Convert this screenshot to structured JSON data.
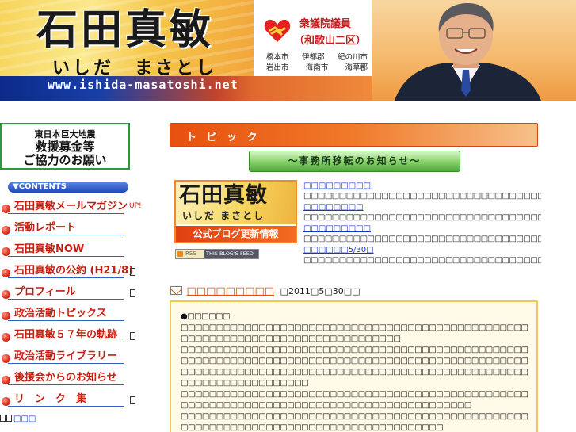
{
  "header": {
    "name": "石田真敏",
    "name_kana": "いしだ　まさとし",
    "url": "www.ishida-masatoshi.net",
    "office_title": "衆議院議員",
    "district": "（和歌山二区）",
    "areas": [
      [
        "橋本市",
        "伊都郡",
        "紀の川市"
      ],
      [
        "岩出市",
        "海南市",
        "海草郡"
      ]
    ],
    "heart_icon": "heart-handshake-icon",
    "colors": {
      "band_blue": "#0c2a8a",
      "accent_orange": "#e8500e",
      "title_red": "#c02020"
    }
  },
  "sidebar": {
    "relief_banner": {
      "line1": "東日本巨大地震",
      "line2": "救援募金等",
      "line3": "ご協力のお願い"
    },
    "contents_label": "▼CONTENTS",
    "items": [
      {
        "label": "石田真敏メールマガジン",
        "extra": "UP!"
      },
      {
        "label": "活動レポート"
      },
      {
        "label": "石田真敏NOW"
      },
      {
        "label": "石田真敏の公約 (H21/8)",
        "box": true
      },
      {
        "label": "プロフィール",
        "box": true
      },
      {
        "label": "政治活動トピックス"
      },
      {
        "label": "石田真敏５７年の軌跡",
        "box": true
      },
      {
        "label": "政治活動ライブラリー"
      },
      {
        "label": "後援会からのお知らせ"
      },
      {
        "label": "リ　ン　ク　集",
        "box": true
      }
    ],
    "footer_link": "□□□"
  },
  "main": {
    "topic_label": "ト ピ ッ ク",
    "notice_button": "～事務所移転のお知らせ～",
    "blog_banner": {
      "name": "石田真敏",
      "kana": "いしだ まさとし",
      "caption": "公式ブログ更新情報"
    },
    "rss": {
      "left": "RSS",
      "right": "THIS BLOG'S FEED"
    },
    "news": [
      {
        "title": "□□□□□□□□□",
        "body": "□□□□□□□□□□□□□□□□□□□□□□□□□□□□□□□□□□□□□□□□□□□□□□□□□□□□"
      },
      {
        "title": "□□□□□□□□",
        "body": "□□□□□□□□□□□□□□□□□□□□□□□□□□□□□□□□□□□□□□□□□□□□□□□□□□□□"
      },
      {
        "title": "□□□□□□□□□",
        "body": "□□□□□□□□□□□□□□□□□□□□□□□□□□□□□□□□□□□□9□□□□□□□□□□□□□□□"
      },
      {
        "title": "□□□□□□5/30□",
        "body": "□□□□□□□□□□□□□□□□□□□□□□□□□□□□□□□□□□□□□□□□□□□□□□□□□□□□"
      }
    ],
    "article": {
      "title": "□□□□□□□□□",
      "date": "□2011□5□30□□",
      "heading": "●□□□□□□",
      "paragraphs": [
        "□□□□□□□□□□□□□□□□□□□□□□□□□□□□□□□□□□□□□□□□□□□□□□□□□□□□□□□□□□□□□□□□□□□□□□□□□□□□□□□□",
        "□□□□□□□□□□□□□□□□□□□□□□□□□□□□□□□□□□□□□□□□□□□□□□□□□□□□□□□□□□□□□□□□□□□□□□□□□□□□□□□□□□□□□□□□□□□□□□□□□□□□□□□□□□□□□□□□□□□□□□□□□□□□□□□□□□□□□□□□□□□□□□□□□□□□□□□□□□□□□□□□□□□□□",
        "□□□□□□□□□□□□□□□□□□□□□□□□□□□□□□□□□□□□□□□□□□□□□□□□□□□□□□□□□□□□□□□□□□□□□□□□□□□□□□□□□□□□□□□□□□",
        "□□□□□□□□□□□□□□□□□□□□□□□□□□□□□□□□□□□□□□□□□□□□□□□□□□□□□□□□□□□□□□□□□□□□□□□□□□□□□□□□□□□□□□"
      ]
    }
  }
}
